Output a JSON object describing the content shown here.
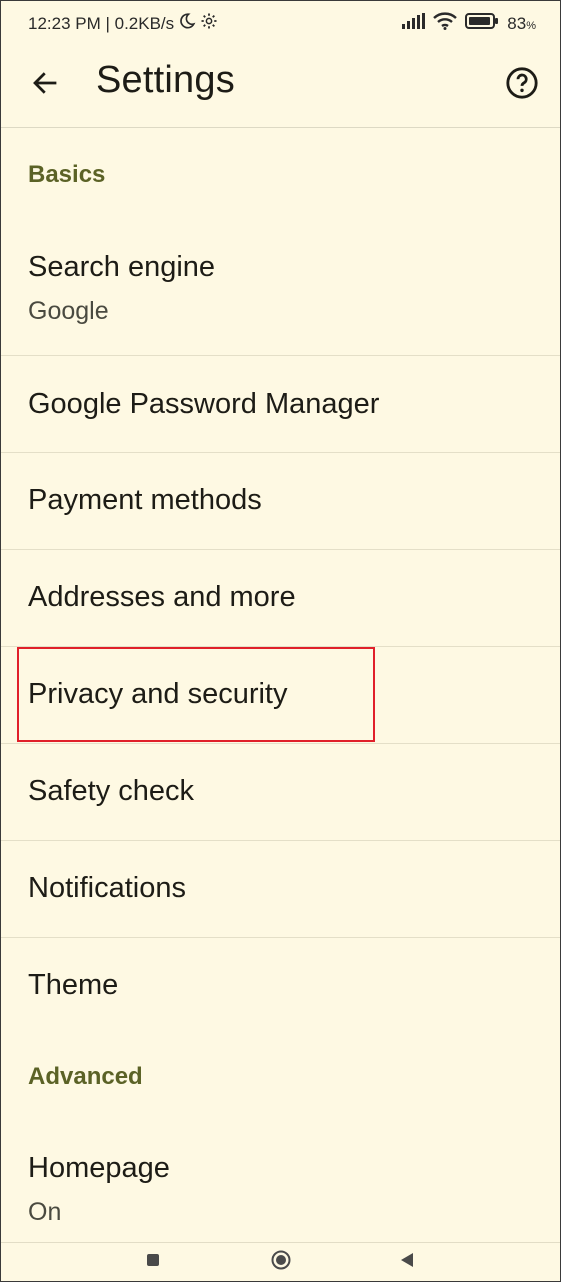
{
  "status_bar": {
    "time_speed": "12:23 PM | 0.2KB/s",
    "battery": "83",
    "battery_unit": "%"
  },
  "app_bar": {
    "title": "Settings"
  },
  "sections": {
    "basics": "Basics",
    "advanced": "Advanced"
  },
  "items": {
    "search_engine": {
      "label": "Search engine",
      "value": "Google"
    },
    "password_manager": {
      "label": "Google Password Manager"
    },
    "payment_methods": {
      "label": "Payment methods"
    },
    "addresses": {
      "label": "Addresses and more"
    },
    "privacy": {
      "label": "Privacy and security"
    },
    "safety_check": {
      "label": "Safety check"
    },
    "notifications": {
      "label": "Notifications"
    },
    "theme": {
      "label": "Theme"
    },
    "homepage": {
      "label": "Homepage",
      "value": "On"
    }
  },
  "colors": {
    "background": "#fef9e3",
    "section_header": "#5b6226",
    "highlight_border": "#e0202a",
    "text_primary": "#1d1c16"
  },
  "icons": {
    "back": "arrow-left-icon",
    "help": "help-circle-icon",
    "moon": "moon-icon",
    "settings_gear": "gear-icon",
    "signal": "signal-icon",
    "wifi": "wifi-icon",
    "battery": "battery-icon",
    "nav_recents": "square-icon",
    "nav_home": "circle-icon",
    "nav_back": "triangle-icon"
  }
}
